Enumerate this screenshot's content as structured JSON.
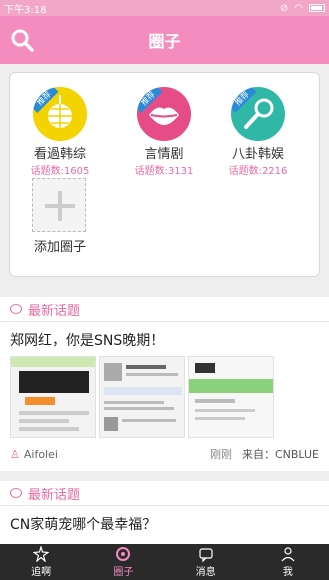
{
  "status": {
    "time": "下午3:18"
  },
  "appbar": {
    "title": "圈子"
  },
  "circles": [
    {
      "name": "看過韩综",
      "count": "话题数:1605",
      "badge": "推荐",
      "color": "#f3d400"
    },
    {
      "name": "言情剧",
      "count": "话题数:3131",
      "badge": "推荐",
      "color": "#e64c86"
    },
    {
      "name": "八卦韩娱",
      "count": "话题数:2216",
      "badge": "推荐",
      "color": "#2fb8a6"
    }
  ],
  "add_circle": {
    "label": "添加圈子"
  },
  "posts": [
    {
      "section": "最新话题",
      "title": "郑网红，你是SNS晚期！",
      "user": "Aifolei",
      "time": "刚刚",
      "source_label": "来自：",
      "source": "CNBLUE"
    },
    {
      "section": "最新话题",
      "title": "CN家萌宠哪个最幸福？"
    }
  ],
  "tabs": [
    {
      "label": "追啊"
    },
    {
      "label": "圈子"
    },
    {
      "label": "消息"
    },
    {
      "label": "我"
    }
  ],
  "colors": {
    "accent": "#f48cbf",
    "count": "#ea6aa8"
  }
}
